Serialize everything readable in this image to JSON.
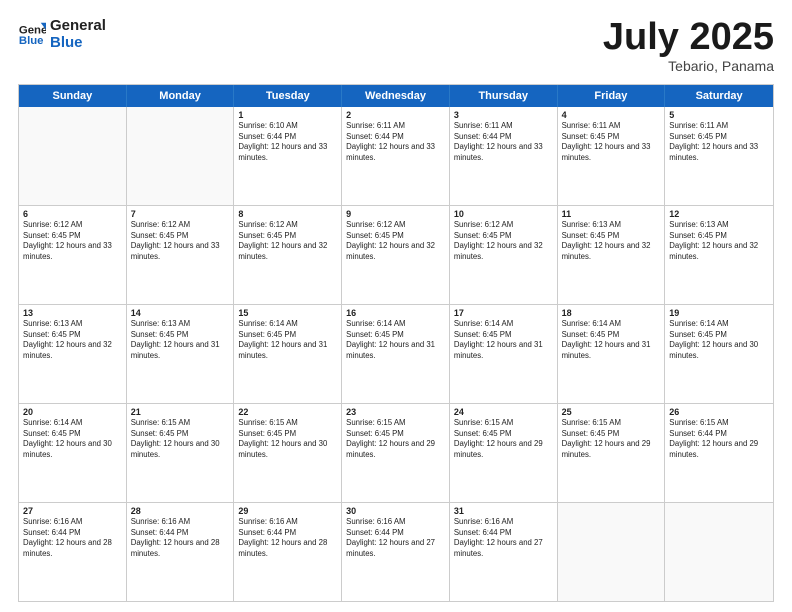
{
  "header": {
    "logo_line1": "General",
    "logo_line2": "Blue",
    "month": "July 2025",
    "location": "Tebario, Panama"
  },
  "weekdays": [
    "Sunday",
    "Monday",
    "Tuesday",
    "Wednesday",
    "Thursday",
    "Friday",
    "Saturday"
  ],
  "rows": [
    [
      {
        "day": "",
        "info": ""
      },
      {
        "day": "",
        "info": ""
      },
      {
        "day": "1",
        "info": "Sunrise: 6:10 AM\nSunset: 6:44 PM\nDaylight: 12 hours and 33 minutes."
      },
      {
        "day": "2",
        "info": "Sunrise: 6:11 AM\nSunset: 6:44 PM\nDaylight: 12 hours and 33 minutes."
      },
      {
        "day": "3",
        "info": "Sunrise: 6:11 AM\nSunset: 6:44 PM\nDaylight: 12 hours and 33 minutes."
      },
      {
        "day": "4",
        "info": "Sunrise: 6:11 AM\nSunset: 6:45 PM\nDaylight: 12 hours and 33 minutes."
      },
      {
        "day": "5",
        "info": "Sunrise: 6:11 AM\nSunset: 6:45 PM\nDaylight: 12 hours and 33 minutes."
      }
    ],
    [
      {
        "day": "6",
        "info": "Sunrise: 6:12 AM\nSunset: 6:45 PM\nDaylight: 12 hours and 33 minutes."
      },
      {
        "day": "7",
        "info": "Sunrise: 6:12 AM\nSunset: 6:45 PM\nDaylight: 12 hours and 33 minutes."
      },
      {
        "day": "8",
        "info": "Sunrise: 6:12 AM\nSunset: 6:45 PM\nDaylight: 12 hours and 32 minutes."
      },
      {
        "day": "9",
        "info": "Sunrise: 6:12 AM\nSunset: 6:45 PM\nDaylight: 12 hours and 32 minutes."
      },
      {
        "day": "10",
        "info": "Sunrise: 6:12 AM\nSunset: 6:45 PM\nDaylight: 12 hours and 32 minutes."
      },
      {
        "day": "11",
        "info": "Sunrise: 6:13 AM\nSunset: 6:45 PM\nDaylight: 12 hours and 32 minutes."
      },
      {
        "day": "12",
        "info": "Sunrise: 6:13 AM\nSunset: 6:45 PM\nDaylight: 12 hours and 32 minutes."
      }
    ],
    [
      {
        "day": "13",
        "info": "Sunrise: 6:13 AM\nSunset: 6:45 PM\nDaylight: 12 hours and 32 minutes."
      },
      {
        "day": "14",
        "info": "Sunrise: 6:13 AM\nSunset: 6:45 PM\nDaylight: 12 hours and 31 minutes."
      },
      {
        "day": "15",
        "info": "Sunrise: 6:14 AM\nSunset: 6:45 PM\nDaylight: 12 hours and 31 minutes."
      },
      {
        "day": "16",
        "info": "Sunrise: 6:14 AM\nSunset: 6:45 PM\nDaylight: 12 hours and 31 minutes."
      },
      {
        "day": "17",
        "info": "Sunrise: 6:14 AM\nSunset: 6:45 PM\nDaylight: 12 hours and 31 minutes."
      },
      {
        "day": "18",
        "info": "Sunrise: 6:14 AM\nSunset: 6:45 PM\nDaylight: 12 hours and 31 minutes."
      },
      {
        "day": "19",
        "info": "Sunrise: 6:14 AM\nSunset: 6:45 PM\nDaylight: 12 hours and 30 minutes."
      }
    ],
    [
      {
        "day": "20",
        "info": "Sunrise: 6:14 AM\nSunset: 6:45 PM\nDaylight: 12 hours and 30 minutes."
      },
      {
        "day": "21",
        "info": "Sunrise: 6:15 AM\nSunset: 6:45 PM\nDaylight: 12 hours and 30 minutes."
      },
      {
        "day": "22",
        "info": "Sunrise: 6:15 AM\nSunset: 6:45 PM\nDaylight: 12 hours and 30 minutes."
      },
      {
        "day": "23",
        "info": "Sunrise: 6:15 AM\nSunset: 6:45 PM\nDaylight: 12 hours and 29 minutes."
      },
      {
        "day": "24",
        "info": "Sunrise: 6:15 AM\nSunset: 6:45 PM\nDaylight: 12 hours and 29 minutes."
      },
      {
        "day": "25",
        "info": "Sunrise: 6:15 AM\nSunset: 6:45 PM\nDaylight: 12 hours and 29 minutes."
      },
      {
        "day": "26",
        "info": "Sunrise: 6:15 AM\nSunset: 6:44 PM\nDaylight: 12 hours and 29 minutes."
      }
    ],
    [
      {
        "day": "27",
        "info": "Sunrise: 6:16 AM\nSunset: 6:44 PM\nDaylight: 12 hours and 28 minutes."
      },
      {
        "day": "28",
        "info": "Sunrise: 6:16 AM\nSunset: 6:44 PM\nDaylight: 12 hours and 28 minutes."
      },
      {
        "day": "29",
        "info": "Sunrise: 6:16 AM\nSunset: 6:44 PM\nDaylight: 12 hours and 28 minutes."
      },
      {
        "day": "30",
        "info": "Sunrise: 6:16 AM\nSunset: 6:44 PM\nDaylight: 12 hours and 27 minutes."
      },
      {
        "day": "31",
        "info": "Sunrise: 6:16 AM\nSunset: 6:44 PM\nDaylight: 12 hours and 27 minutes."
      },
      {
        "day": "",
        "info": ""
      },
      {
        "day": "",
        "info": ""
      }
    ]
  ]
}
